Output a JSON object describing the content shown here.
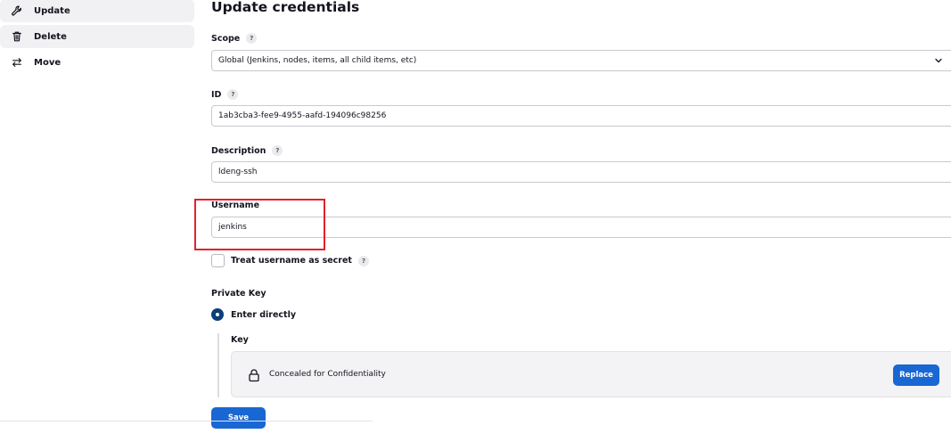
{
  "sidebar": {
    "items": [
      {
        "label": "Update",
        "icon": "wrench-icon"
      },
      {
        "label": "Delete",
        "icon": "trash-icon"
      },
      {
        "label": "Move",
        "icon": "arrows-left-right-icon"
      }
    ]
  },
  "main": {
    "title": "Update credentials",
    "help_glyph": "?",
    "scope": {
      "label": "Scope",
      "value": "Global (Jenkins, nodes, items, all child items, etc)"
    },
    "id": {
      "label": "ID",
      "value": "1ab3cba3-fee9-4955-aafd-194096c98256"
    },
    "description": {
      "label": "Description",
      "value": "ldeng-ssh"
    },
    "username": {
      "label": "Username",
      "value": "jenkins"
    },
    "treat_secret": {
      "label": "Treat username as secret",
      "checked": false
    },
    "private_key": {
      "label": "Private Key",
      "option_label": "Enter directly",
      "key_label": "Key",
      "concealed_text": "Concealed for Confidentiality",
      "replace_label": "Replace"
    },
    "save_label": "Save"
  },
  "colors": {
    "primary": "#1967d2",
    "radio": "#0b3f7a",
    "highlight": "#e3212a",
    "active_bg": "#f1f1f3"
  }
}
